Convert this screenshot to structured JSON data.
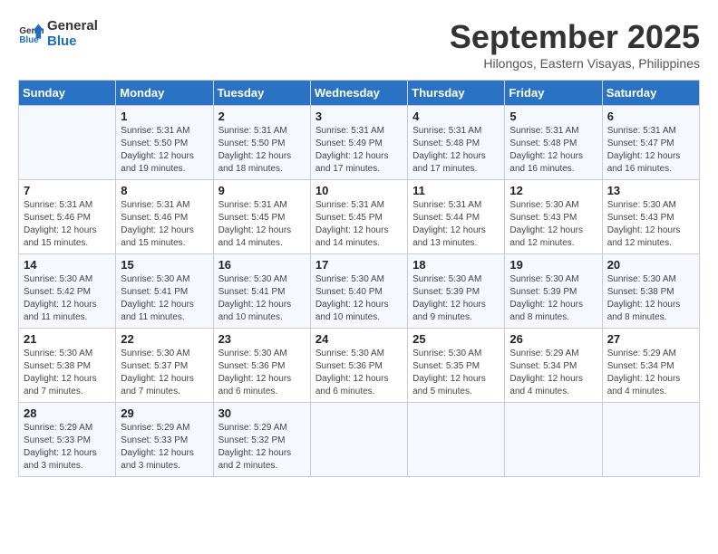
{
  "logo": {
    "line1": "General",
    "line2": "Blue"
  },
  "title": "September 2025",
  "location": "Hilongos, Eastern Visayas, Philippines",
  "days_header": [
    "Sunday",
    "Monday",
    "Tuesday",
    "Wednesday",
    "Thursday",
    "Friday",
    "Saturday"
  ],
  "weeks": [
    [
      {
        "day": "",
        "info": ""
      },
      {
        "day": "1",
        "info": "Sunrise: 5:31 AM\nSunset: 5:50 PM\nDaylight: 12 hours\nand 19 minutes."
      },
      {
        "day": "2",
        "info": "Sunrise: 5:31 AM\nSunset: 5:50 PM\nDaylight: 12 hours\nand 18 minutes."
      },
      {
        "day": "3",
        "info": "Sunrise: 5:31 AM\nSunset: 5:49 PM\nDaylight: 12 hours\nand 17 minutes."
      },
      {
        "day": "4",
        "info": "Sunrise: 5:31 AM\nSunset: 5:48 PM\nDaylight: 12 hours\nand 17 minutes."
      },
      {
        "day": "5",
        "info": "Sunrise: 5:31 AM\nSunset: 5:48 PM\nDaylight: 12 hours\nand 16 minutes."
      },
      {
        "day": "6",
        "info": "Sunrise: 5:31 AM\nSunset: 5:47 PM\nDaylight: 12 hours\nand 16 minutes."
      }
    ],
    [
      {
        "day": "7",
        "info": "Sunrise: 5:31 AM\nSunset: 5:46 PM\nDaylight: 12 hours\nand 15 minutes."
      },
      {
        "day": "8",
        "info": "Sunrise: 5:31 AM\nSunset: 5:46 PM\nDaylight: 12 hours\nand 15 minutes."
      },
      {
        "day": "9",
        "info": "Sunrise: 5:31 AM\nSunset: 5:45 PM\nDaylight: 12 hours\nand 14 minutes."
      },
      {
        "day": "10",
        "info": "Sunrise: 5:31 AM\nSunset: 5:45 PM\nDaylight: 12 hours\nand 14 minutes."
      },
      {
        "day": "11",
        "info": "Sunrise: 5:31 AM\nSunset: 5:44 PM\nDaylight: 12 hours\nand 13 minutes."
      },
      {
        "day": "12",
        "info": "Sunrise: 5:30 AM\nSunset: 5:43 PM\nDaylight: 12 hours\nand 12 minutes."
      },
      {
        "day": "13",
        "info": "Sunrise: 5:30 AM\nSunset: 5:43 PM\nDaylight: 12 hours\nand 12 minutes."
      }
    ],
    [
      {
        "day": "14",
        "info": "Sunrise: 5:30 AM\nSunset: 5:42 PM\nDaylight: 12 hours\nand 11 minutes."
      },
      {
        "day": "15",
        "info": "Sunrise: 5:30 AM\nSunset: 5:41 PM\nDaylight: 12 hours\nand 11 minutes."
      },
      {
        "day": "16",
        "info": "Sunrise: 5:30 AM\nSunset: 5:41 PM\nDaylight: 12 hours\nand 10 minutes."
      },
      {
        "day": "17",
        "info": "Sunrise: 5:30 AM\nSunset: 5:40 PM\nDaylight: 12 hours\nand 10 minutes."
      },
      {
        "day": "18",
        "info": "Sunrise: 5:30 AM\nSunset: 5:39 PM\nDaylight: 12 hours\nand 9 minutes."
      },
      {
        "day": "19",
        "info": "Sunrise: 5:30 AM\nSunset: 5:39 PM\nDaylight: 12 hours\nand 8 minutes."
      },
      {
        "day": "20",
        "info": "Sunrise: 5:30 AM\nSunset: 5:38 PM\nDaylight: 12 hours\nand 8 minutes."
      }
    ],
    [
      {
        "day": "21",
        "info": "Sunrise: 5:30 AM\nSunset: 5:38 PM\nDaylight: 12 hours\nand 7 minutes."
      },
      {
        "day": "22",
        "info": "Sunrise: 5:30 AM\nSunset: 5:37 PM\nDaylight: 12 hours\nand 7 minutes."
      },
      {
        "day": "23",
        "info": "Sunrise: 5:30 AM\nSunset: 5:36 PM\nDaylight: 12 hours\nand 6 minutes."
      },
      {
        "day": "24",
        "info": "Sunrise: 5:30 AM\nSunset: 5:36 PM\nDaylight: 12 hours\nand 6 minutes."
      },
      {
        "day": "25",
        "info": "Sunrise: 5:30 AM\nSunset: 5:35 PM\nDaylight: 12 hours\nand 5 minutes."
      },
      {
        "day": "26",
        "info": "Sunrise: 5:29 AM\nSunset: 5:34 PM\nDaylight: 12 hours\nand 4 minutes."
      },
      {
        "day": "27",
        "info": "Sunrise: 5:29 AM\nSunset: 5:34 PM\nDaylight: 12 hours\nand 4 minutes."
      }
    ],
    [
      {
        "day": "28",
        "info": "Sunrise: 5:29 AM\nSunset: 5:33 PM\nDaylight: 12 hours\nand 3 minutes."
      },
      {
        "day": "29",
        "info": "Sunrise: 5:29 AM\nSunset: 5:33 PM\nDaylight: 12 hours\nand 3 minutes."
      },
      {
        "day": "30",
        "info": "Sunrise: 5:29 AM\nSunset: 5:32 PM\nDaylight: 12 hours\nand 2 minutes."
      },
      {
        "day": "",
        "info": ""
      },
      {
        "day": "",
        "info": ""
      },
      {
        "day": "",
        "info": ""
      },
      {
        "day": "",
        "info": ""
      }
    ]
  ]
}
